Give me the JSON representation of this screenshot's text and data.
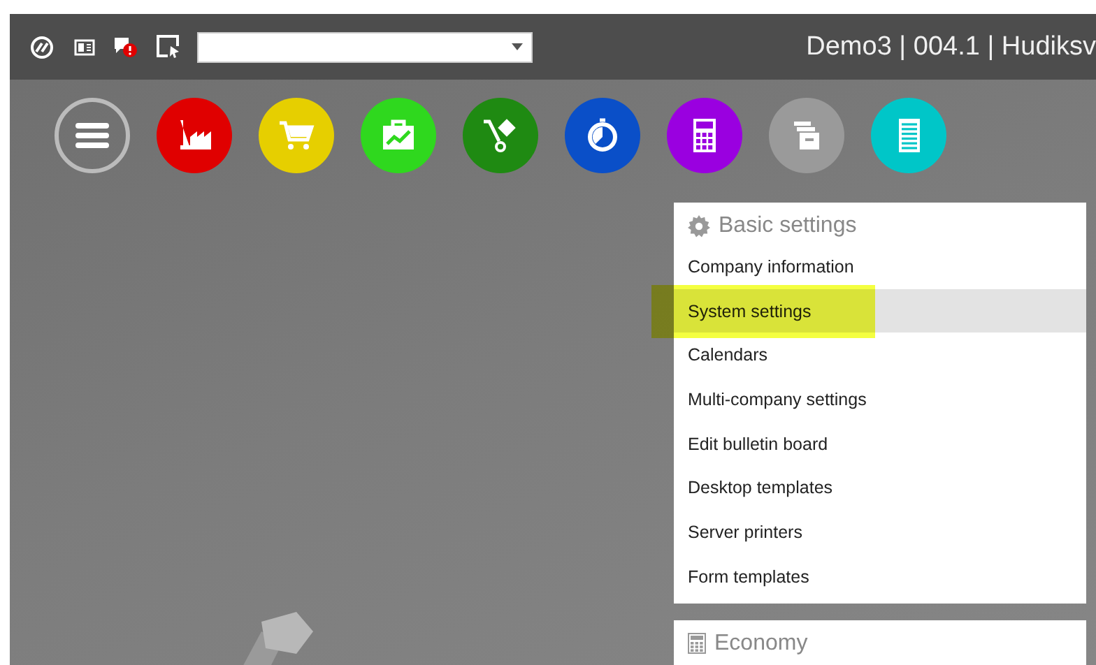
{
  "top_bar": {
    "tools": [
      {
        "kind": "logo"
      },
      {
        "kind": "layout"
      },
      {
        "kind": "alert"
      },
      {
        "kind": "pointer"
      }
    ],
    "title": "Demo3 | 004.1 | Hudiksv"
  },
  "modules": [
    {
      "kind": "menu"
    },
    {
      "kind": "factory",
      "color": "#e00000"
    },
    {
      "kind": "cart",
      "color": "#e6cf00"
    },
    {
      "kind": "briefcase",
      "color": "#2fd81e"
    },
    {
      "kind": "trolley",
      "color": "#1f8a12"
    },
    {
      "kind": "timer",
      "color": "#0a4fc8"
    },
    {
      "kind": "calculator",
      "color": "#9a00e0"
    },
    {
      "kind": "files",
      "color": "#9a9a9a"
    },
    {
      "kind": "list",
      "color": "#00c6c8"
    }
  ],
  "menu_sections": [
    {
      "kind": "gear",
      "title": "Basic settings",
      "items": [
        {
          "label": "Company information",
          "selected": false
        },
        {
          "label": "System settings",
          "selected": true
        },
        {
          "label": "Calendars",
          "selected": false
        },
        {
          "label": "Multi-company settings",
          "selected": false
        },
        {
          "label": "Edit bulletin board",
          "selected": false
        },
        {
          "label": "Desktop templates",
          "selected": false
        },
        {
          "label": "Server printers",
          "selected": false
        },
        {
          "label": "Form templates",
          "selected": false
        }
      ]
    },
    {
      "kind": "calculator",
      "title": "Economy"
    }
  ]
}
